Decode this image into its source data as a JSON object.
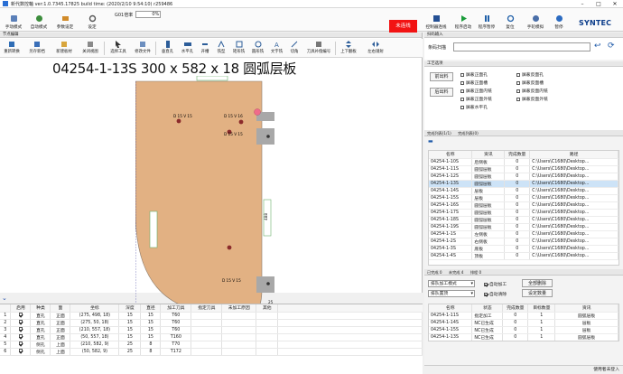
{
  "window": {
    "title": "新代数控軸 ver:1.0.7345.17825 build time: (2020/2/10 9:54:10) r259486"
  },
  "toolbar": {
    "items": [
      {
        "label": "手动模式"
      },
      {
        "label": "自动模式"
      },
      {
        "label": "参数设定"
      },
      {
        "label": "设定"
      }
    ],
    "g01_label": "G01倍率",
    "g01_value": "0%",
    "estop_label": "未连线",
    "right_items": [
      {
        "label": "控制器连线"
      },
      {
        "label": "程序启动"
      },
      {
        "label": "程序暂停"
      },
      {
        "label": "复位"
      },
      {
        "label": "手轮模拟"
      },
      {
        "label": "暂停"
      }
    ],
    "brand": "SYNTEC"
  },
  "left_panel": {
    "header": "节点编辑",
    "tools": [
      {
        "label": "重新转换"
      },
      {
        "label": "另存新档"
      },
      {
        "label": "新建板材"
      },
      {
        "label": "关闭视图"
      },
      {
        "label": "选择工具"
      },
      {
        "label": "修改文件"
      },
      {
        "label": "垂直孔"
      },
      {
        "label": "水平孔"
      },
      {
        "label": "开槽"
      },
      {
        "label": "铣型"
      },
      {
        "label": "矩形铣"
      },
      {
        "label": "圆形铣"
      },
      {
        "label": "文字铣"
      },
      {
        "label": "切角"
      },
      {
        "label": "刀具补偿编号"
      },
      {
        "label": "上下翻板"
      },
      {
        "label": "左右镜射"
      }
    ]
  },
  "drawing": {
    "title": "04254-1-13S   300 x 582 x 18 圆弧层板",
    "dims": {
      "width_label": "275",
      "height_label": "557",
      "side_label": "25",
      "side_label_right": "25",
      "right_v": "488"
    },
    "holes": [
      {
        "label": "D 15 V 15"
      },
      {
        "label": "D 15 V 16"
      },
      {
        "label": "D 15 V 15"
      },
      {
        "label": "D 15 V 15"
      }
    ]
  },
  "bottom_table": {
    "columns": [
      "",
      "启用",
      "种类",
      "面",
      "坐标",
      "深度",
      "直径",
      "加工刀具",
      "指定刀具",
      "未加工原因",
      "其他"
    ],
    "rows": [
      {
        "no": "1",
        "on": true,
        "kind": "直孔",
        "face": "正面",
        "coord": "(275, 498, 18)",
        "depth": "15",
        "dia": "15",
        "tool": "T60"
      },
      {
        "no": "2",
        "on": true,
        "kind": "直孔",
        "face": "正面",
        "coord": "(275, 50, 18)",
        "depth": "15",
        "dia": "15",
        "tool": "T60"
      },
      {
        "no": "3",
        "on": true,
        "kind": "直孔",
        "face": "正面",
        "coord": "(210, 557, 18)",
        "depth": "15",
        "dia": "15",
        "tool": "T60"
      },
      {
        "no": "4",
        "on": true,
        "kind": "直孔",
        "face": "正面",
        "coord": "(50, 557, 18)",
        "depth": "15",
        "dia": "15",
        "tool": "T160"
      },
      {
        "no": "5",
        "on": true,
        "kind": "侧孔",
        "face": "上面",
        "coord": "(210, 582, 9)",
        "depth": "25",
        "dia": "8",
        "tool": "T70"
      },
      {
        "no": "6",
        "on": true,
        "kind": "侧孔",
        "face": "上面",
        "coord": "(50, 582, 9)",
        "depth": "25",
        "dia": "8",
        "tool": "T172"
      }
    ]
  },
  "right_panel": {
    "search_header": "扫码输入",
    "search_label": "条码扫描",
    "process_header": "工艺选项",
    "btn_out": "前出料",
    "btn_back": "后出料",
    "options": [
      "屏蔽正面孔",
      "屏蔽正面槽",
      "屏蔽正面内铣",
      "屏蔽正面外铣",
      "屏蔽水平孔",
      "屏蔽反面孔",
      "屏蔽反面槽",
      "屏蔽反面内铣",
      "屏蔽反面外铣"
    ],
    "list_tabs": [
      "完成列表(1/1)",
      "完成列表(0)"
    ],
    "list_columns": [
      "名称",
      "资讯",
      "完成数量",
      "路径"
    ],
    "list_rows": [
      {
        "name": "04254-1-10S",
        "info": "后侧板",
        "done": "0",
        "path": "C:\\Users\\C1680\\Desktop..."
      },
      {
        "name": "04254-1-11S",
        "info": "圆弧层板",
        "done": "0",
        "path": "C:\\Users\\C1680\\Desktop..."
      },
      {
        "name": "04254-1-12S",
        "info": "圆弧层板",
        "done": "0",
        "path": "C:\\Users\\C1680\\Desktop..."
      },
      {
        "name": "04254-1-13S",
        "info": "圆弧层板",
        "done": "0",
        "path": "C:\\Users\\C1680\\Desktop...",
        "selected": true
      },
      {
        "name": "04254-1-14S",
        "info": "层板",
        "done": "0",
        "path": "C:\\Users\\C1680\\Desktop..."
      },
      {
        "name": "04254-1-15S",
        "info": "层板",
        "done": "0",
        "path": "C:\\Users\\C1680\\Desktop..."
      },
      {
        "name": "04254-1-16S",
        "info": "圆弧层板",
        "done": "0",
        "path": "C:\\Users\\C1680\\Desktop..."
      },
      {
        "name": "04254-1-17S",
        "info": "圆弧层板",
        "done": "0",
        "path": "C:\\Users\\C1680\\Desktop..."
      },
      {
        "name": "04254-1-18S",
        "info": "圆弧层板",
        "done": "0",
        "path": "C:\\Users\\C1680\\Desktop..."
      },
      {
        "name": "04254-1-19S",
        "info": "圆弧层板",
        "done": "0",
        "path": "C:\\Users\\C1680\\Desktop..."
      },
      {
        "name": "04254-1-1S",
        "info": "左侧板",
        "done": "0",
        "path": "C:\\Users\\C1680\\Desktop..."
      },
      {
        "name": "04254-1-2S",
        "info": "右侧板",
        "done": "0",
        "path": "C:\\Users\\C1680\\Desktop..."
      },
      {
        "name": "04254-1-3S",
        "info": "底板",
        "done": "0",
        "path": "C:\\Users\\C1680\\Desktop..."
      },
      {
        "name": "04254-1-4S",
        "info": "顶板",
        "done": "0",
        "path": "C:\\Users\\C1680\\Desktop..."
      }
    ],
    "bottom_tabs": [
      "已完成 0",
      "未完成 4",
      "排程 0"
    ],
    "sort_select": "排队加工模式",
    "mode_select": "排队置顶",
    "auto_in": "自动加工",
    "auto_out": "自动清除",
    "btn_clear": "全部删除",
    "btn_set": "设定数量",
    "queue_columns": [
      "名称",
      "状态",
      "完成数量",
      "目标数量",
      "资讯"
    ],
    "queue_rows": [
      {
        "name": "04254-1-11S",
        "status": "指定加工",
        "done": "0",
        "target": "1",
        "info": "圆弧层板"
      },
      {
        "name": "04254-1-14S",
        "status": "NC已生成",
        "done": "0",
        "target": "1",
        "info": "层板"
      },
      {
        "name": "04254-1-15S",
        "status": "NC已生成",
        "done": "0",
        "target": "1",
        "info": "层板"
      },
      {
        "name": "04254-1-13S",
        "status": "NC已生成",
        "done": "0",
        "target": "1",
        "info": "圆弧层板"
      }
    ],
    "status_text": "使用者未登入"
  }
}
